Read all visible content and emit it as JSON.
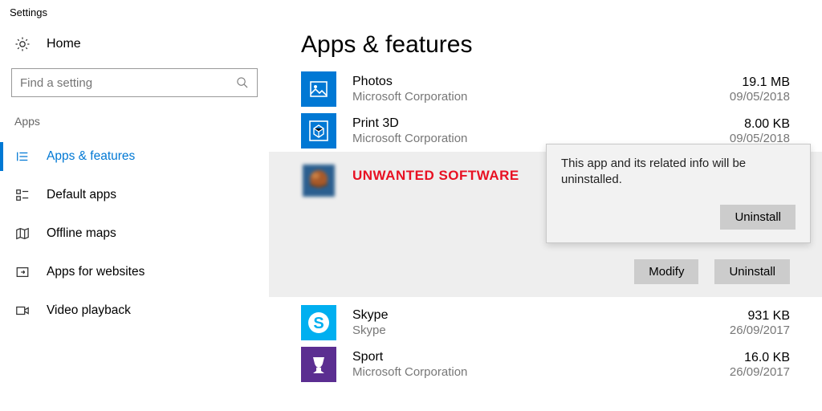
{
  "window_title": "Settings",
  "home_label": "Home",
  "search_placeholder": "Find a setting",
  "section_label": "Apps",
  "nav": [
    {
      "label": "Apps & features"
    },
    {
      "label": "Default apps"
    },
    {
      "label": "Offline maps"
    },
    {
      "label": "Apps for websites"
    },
    {
      "label": "Video playback"
    }
  ],
  "page_title": "Apps & features",
  "apps": {
    "photos": {
      "name": "Photos",
      "publisher": "Microsoft Corporation",
      "size": "19.1 MB",
      "date": "09/05/2018"
    },
    "print3d": {
      "name": "Print 3D",
      "publisher": "Microsoft Corporation",
      "size": "8.00 KB",
      "date": "09/05/2018"
    },
    "unwanted": {
      "name": "UNWANTED SOFTWARE"
    },
    "skype": {
      "name": "Skype",
      "publisher": "Skype",
      "size": "931 KB",
      "date": "26/09/2017"
    },
    "sport": {
      "name": "Sport",
      "publisher": "Microsoft Corporation",
      "size": "16.0 KB",
      "date": "26/09/2017"
    }
  },
  "buttons": {
    "modify": "Modify",
    "uninstall": "Uninstall",
    "flyout_uninstall": "Uninstall"
  },
  "flyout_msg": "This app and its related info will be uninstalled.",
  "colors": {
    "accent": "#0078d4",
    "danger": "#e81123"
  }
}
